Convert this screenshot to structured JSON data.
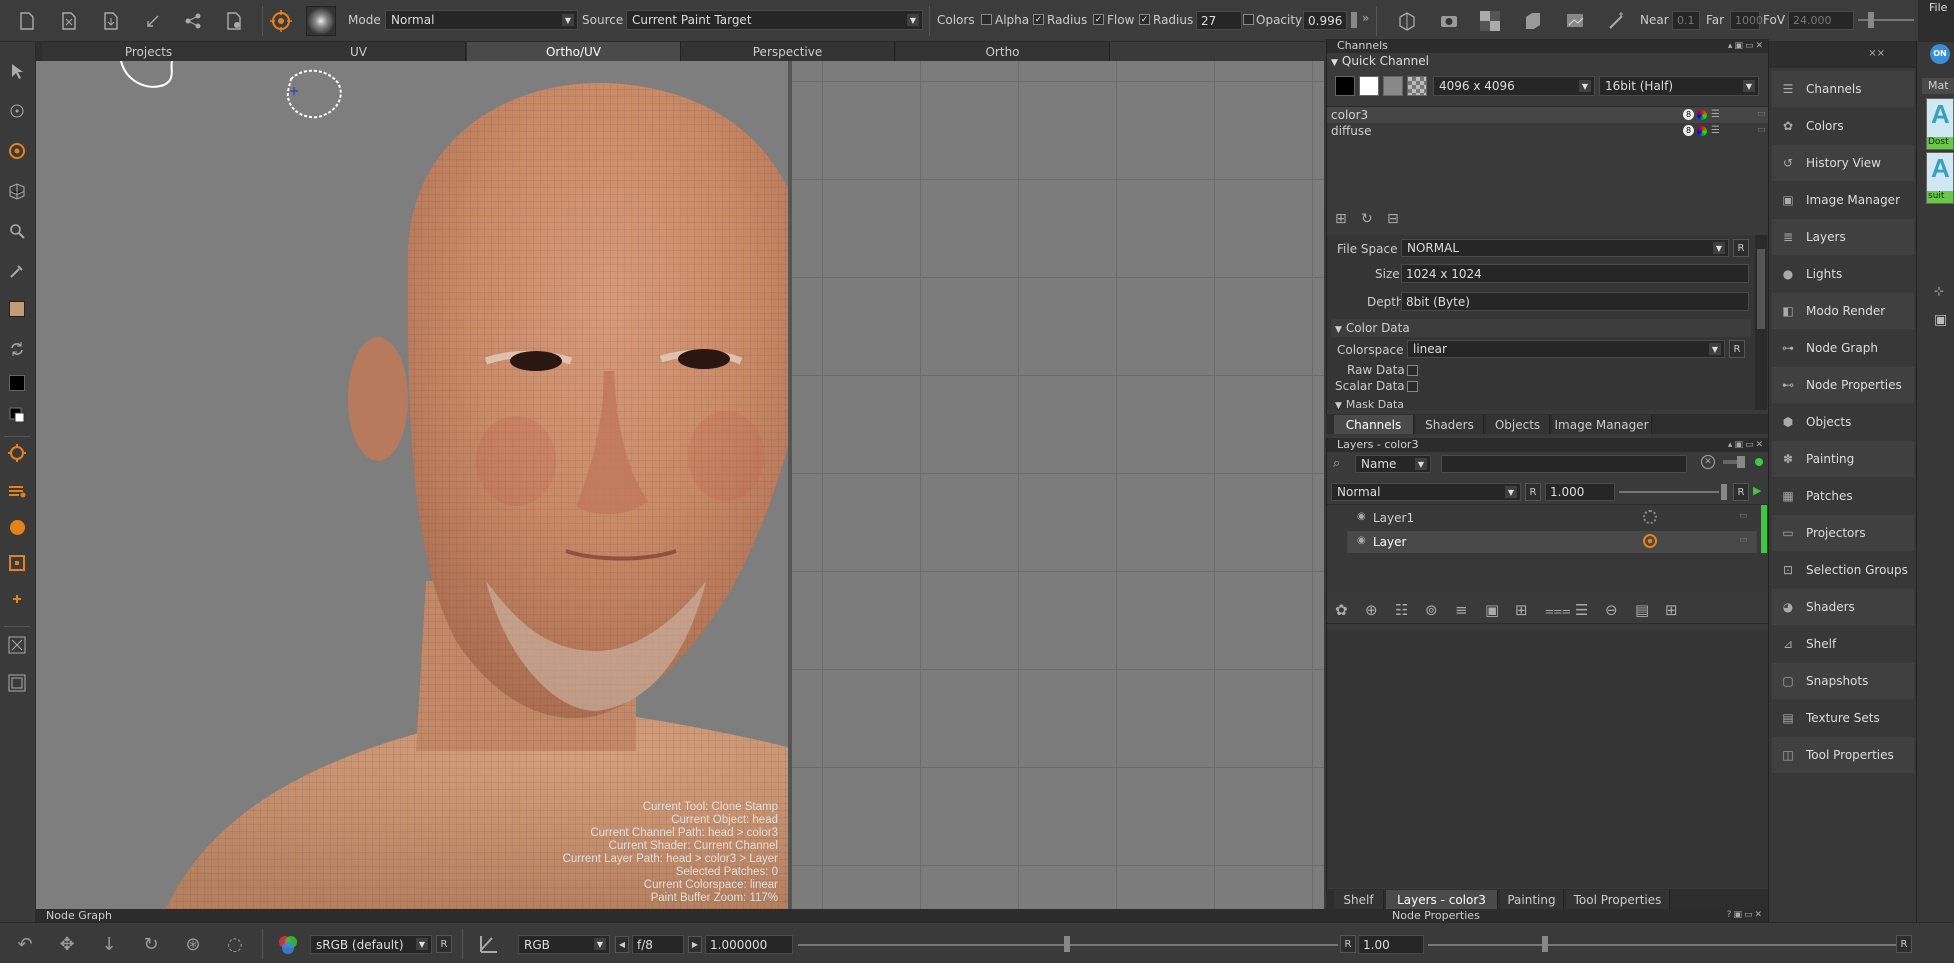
{
  "toolbar": {
    "mode_label": "Mode",
    "mode_value": "Normal",
    "source_label": "Source",
    "source_value": "Current Paint Target",
    "colors_label": "Colors",
    "alpha_label": "Alpha",
    "radius_label": "Radius",
    "flow_label": "Flow",
    "radius2_label": "Radius",
    "radius_value": "27",
    "opacity_label": "Opacity",
    "opacity_value": "0.996",
    "near_label": "Near",
    "near_value": "0.1",
    "far_label": "Far",
    "far_value": "1000",
    "fov_label": "FoV",
    "fov_value": "24.000",
    "file_menu": "File"
  },
  "viewport_tabs": [
    "Projects",
    "UV",
    "Ortho/UV",
    "Perspective",
    "Ortho"
  ],
  "active_viewport_tab": "Ortho/UV",
  "viewport_info": [
    "Current Tool: Clone Stamp",
    "Current Object: head",
    "Current Channel Path: head > color3",
    "Current Shader: Current Channel",
    "Current Layer Path: head > color3 > Layer",
    "Selected Patches: 0",
    "Current Colorspace: linear",
    "Paint Buffer Zoom: 117%"
  ],
  "channels_panel": {
    "title": "Channels",
    "quick_channel": "Quick Channel",
    "size_value": "4096 x 4096",
    "depth_value": "16bit (Half)",
    "channels": [
      {
        "name": "color3",
        "badge": "8"
      },
      {
        "name": "diffuse",
        "badge": "8"
      }
    ],
    "file_space_label": "File Space",
    "file_space_value": "NORMAL",
    "size_label": "Size",
    "size_prop": "1024 x 1024",
    "depth_label": "Depth",
    "depth_prop": "8bit  (Byte)",
    "color_data_header": "Color Data",
    "colorspace_label": "Colorspace",
    "colorspace_value": "linear",
    "raw_data_label": "Raw Data",
    "scalar_data_label": "Scalar Data",
    "mask_data_header": "Mask Data",
    "r_label": "R"
  },
  "mid_tabs": [
    "Channels",
    "Shaders",
    "Objects",
    "Image Manager"
  ],
  "layers_panel": {
    "title": "Layers - color3",
    "filter_value": "Name",
    "blend_value": "Normal",
    "opacity_value": "1.000",
    "layers": [
      {
        "name": "Layer1"
      },
      {
        "name": "Layer"
      }
    ]
  },
  "bottom_tabs": [
    "Shelf",
    "Layers - color3",
    "Painting",
    "Tool Properties"
  ],
  "node_graph_label": "Node Graph",
  "node_properties_label": "Node Properties",
  "statusbar": {
    "lut_value": "sRGB (default)",
    "r_label": "R",
    "channel_value": "RGB",
    "fstop_value": "f/8",
    "gain_value": "1.000000",
    "r2_label": "R",
    "gamma_value": "1.00",
    "r3_label": "R"
  },
  "side_palette": [
    "Channels",
    "Colors",
    "History View",
    "Image Manager",
    "Layers",
    "Lights",
    "Modo Render",
    "Node Graph",
    "Node Properties",
    "Objects",
    "Painting",
    "Patches",
    "Projectors",
    "Selection Groups",
    "Shaders",
    "Shelf",
    "Snapshots",
    "Texture Sets",
    "Tool Properties"
  ],
  "far_right": {
    "on_badge": "ON",
    "tab_label": "Mat",
    "thumb1_label": "Dost",
    "thumb2_label": "suit"
  },
  "colors": {
    "accent_orange": "#e8801a",
    "active_green": "#3fc83f"
  }
}
